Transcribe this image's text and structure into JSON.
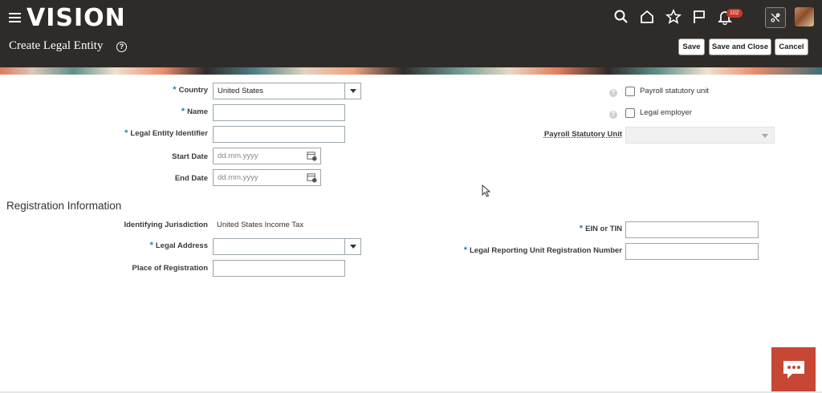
{
  "app": {
    "logo": "VISION",
    "notification_count": "102"
  },
  "page": {
    "title": "Create Legal Entity"
  },
  "toolbar": {
    "save": "Save",
    "save_and_close": "Save and Close",
    "cancel": "Cancel"
  },
  "form": {
    "country": {
      "label": "Country",
      "value": "United States"
    },
    "name": {
      "label": "Name",
      "value": ""
    },
    "legal_entity_identifier": {
      "label": "Legal Entity Identifier",
      "value": ""
    },
    "start_date": {
      "label": "Start Date",
      "placeholder": "dd.mm.yyyy"
    },
    "end_date": {
      "label": "End Date",
      "placeholder": "dd.mm.yyyy"
    },
    "payroll_statutory_unit_checkbox": {
      "label": "Payroll statutory unit"
    },
    "legal_employer_checkbox": {
      "label": "Legal employer"
    },
    "payroll_statutory_unit_select": {
      "label": "Payroll Statutory Unit",
      "value": ""
    }
  },
  "registration": {
    "title": "Registration Information",
    "identifying_jurisdiction": {
      "label": "Identifying Jurisdiction",
      "value": "United States Income Tax"
    },
    "legal_address": {
      "label": "Legal Address",
      "value": ""
    },
    "place_of_registration": {
      "label": "Place of Registration",
      "value": ""
    },
    "ein_or_tin": {
      "label": "EIN or TIN",
      "value": ""
    },
    "legal_reporting_unit_registration_number": {
      "label": "Legal Reporting Unit Registration Number",
      "value": ""
    }
  },
  "icons": {
    "menu": "hamburger-icon",
    "search": "search-icon",
    "home": "home-icon",
    "favorites": "star-icon",
    "flag": "flag-icon",
    "notifications": "bell-icon",
    "tools": "tools-icon",
    "chat": "chat-icon",
    "calendar": "calendar-icon",
    "help": "help-icon"
  },
  "colors": {
    "header_bg": "#2f2b29",
    "required_asterisk": "#2f7fa0",
    "chat_bg": "#c74634",
    "badge": "#c6392c"
  }
}
